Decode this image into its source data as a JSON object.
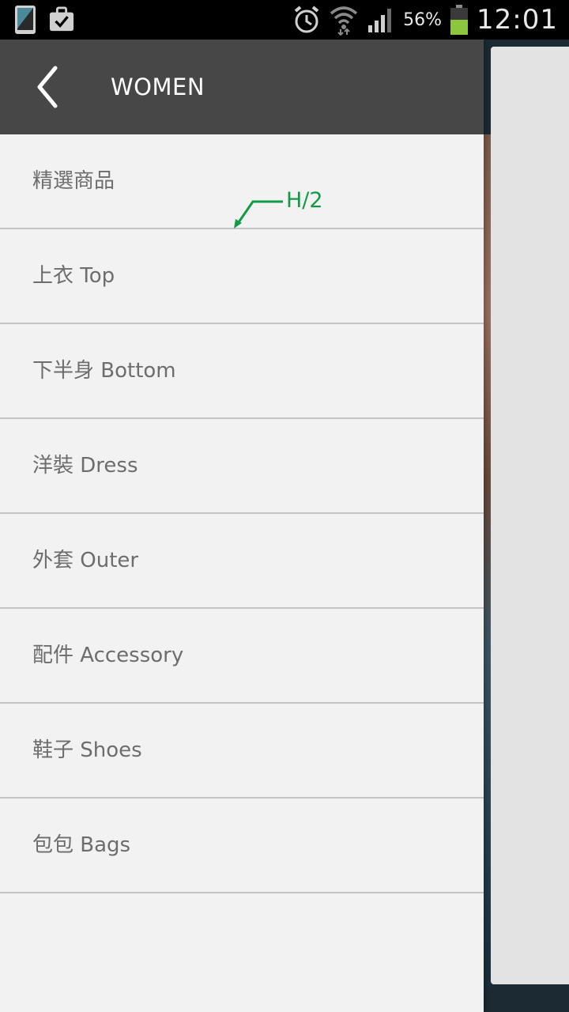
{
  "status_bar": {
    "battery_percent": "56%",
    "time": "12:01",
    "icons": [
      "phone-icon",
      "briefcase-check-icon",
      "alarm-icon",
      "wifi-icon",
      "signal-icon",
      "battery-icon"
    ]
  },
  "drawer": {
    "title": "WOMEN",
    "items": [
      {
        "label": "精選商品"
      },
      {
        "label": "上衣 Top"
      },
      {
        "label": "下半身 Bottom"
      },
      {
        "label": "洋裝 Dress"
      },
      {
        "label": "外套 Outer"
      },
      {
        "label": "配件 Accessory"
      },
      {
        "label": "鞋子 Shoes"
      },
      {
        "label": "包包 Bags"
      }
    ]
  },
  "annotation": {
    "label": "H/2",
    "color": "#139a48"
  },
  "colors": {
    "header_bg": "#474747",
    "drawer_bg": "#f2f2f2",
    "item_text": "#6d6d6d",
    "battery_fill": "#8cc63f"
  }
}
